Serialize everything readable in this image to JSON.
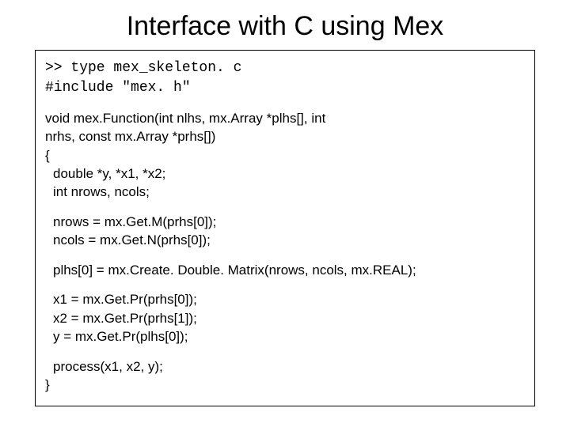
{
  "title": "Interface with C using Mex",
  "code": {
    "prompt": ">> type mex_skeleton. c",
    "include": "#include \"mex. h\"",
    "sig1": "void mex.Function(int nlhs, mx.Array *plhs[], int",
    "sig2": "nrhs, const mx.Array *prhs[])",
    "brace_open": "{",
    "decl1": "double *y, *x1, *x2;",
    "decl2": "int nrows, ncols;",
    "nrows": "nrows = mx.Get.M(prhs[0]);",
    "ncols": "ncols = mx.Get.N(prhs[0]);",
    "plhs": "plhs[0] = mx.Create. Double. Matrix(nrows, ncols, mx.REAL);",
    "x1": "x1 = mx.Get.Pr(prhs[0]);",
    "x2": "x2 = mx.Get.Pr(prhs[1]);",
    "y": "y = mx.Get.Pr(plhs[0]);",
    "process": "process(x1, x2, y);",
    "brace_close": "}"
  }
}
